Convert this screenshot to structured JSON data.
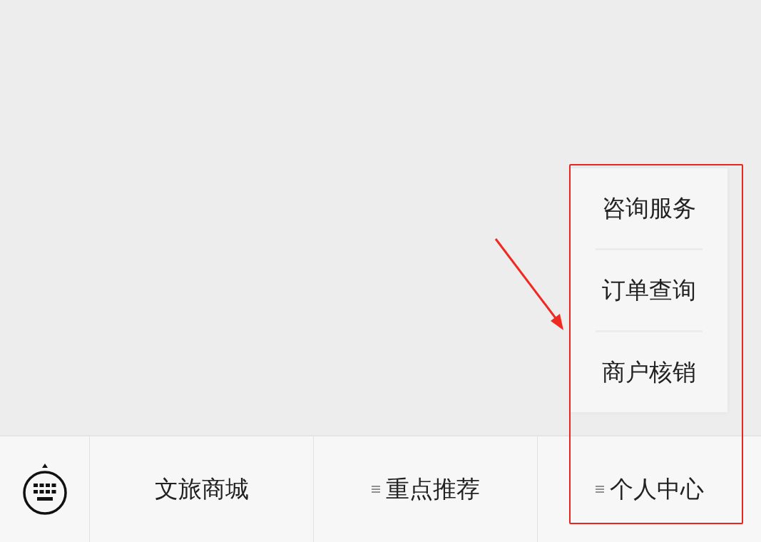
{
  "menu_bar": {
    "tabs": [
      {
        "label": "文旅商城",
        "has_submenu": false
      },
      {
        "label": "重点推荐",
        "has_submenu": true
      },
      {
        "label": "个人中心",
        "has_submenu": true,
        "submenu": [
          "咨询服务",
          "订单查询",
          "商户核销"
        ]
      }
    ]
  }
}
